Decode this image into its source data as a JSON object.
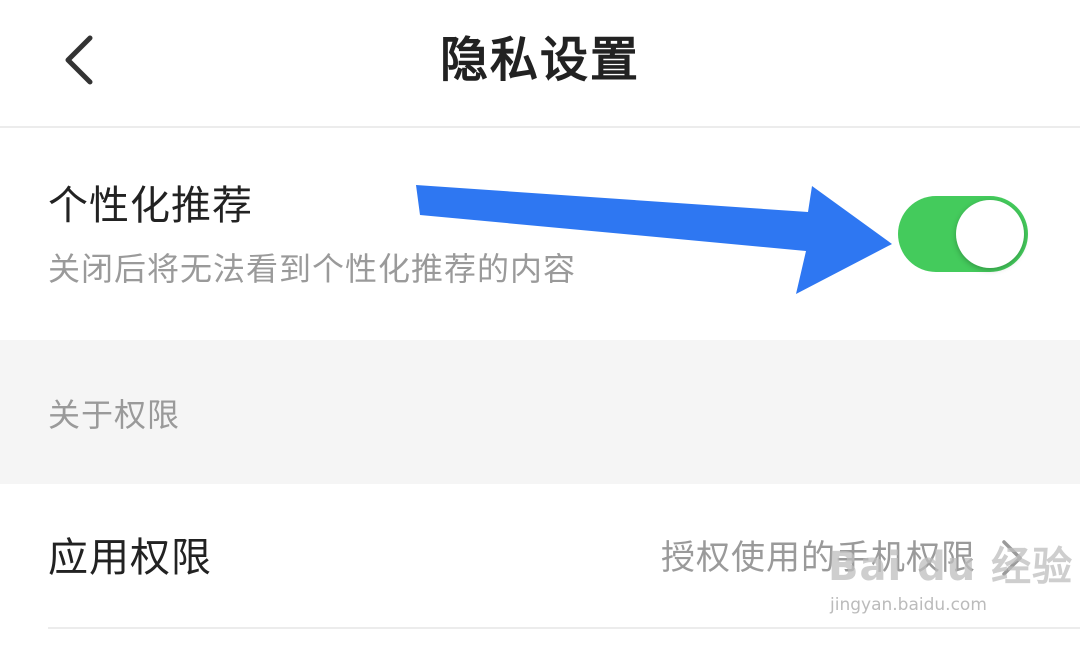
{
  "header": {
    "title": "隐私设置",
    "back_icon": "chevron-left-icon"
  },
  "recommendation": {
    "title": "个性化推荐",
    "description": "关闭后将无法看到个性化推荐的内容",
    "toggle_on": true,
    "toggle_color": "#44cb5c"
  },
  "annotation": {
    "arrow_color": "#2e77f2",
    "arrow_icon": "arrow-right-icon"
  },
  "section": {
    "label": "关于权限"
  },
  "permissions_row": {
    "title": "应用权限",
    "value": "授权使用的手机权限",
    "chevron_icon": "chevron-right-icon"
  },
  "watermark": {
    "logo_text": "Bai du 经验",
    "url": "jingyan.baidu.com"
  },
  "colors": {
    "background": "#ffffff",
    "section_bg": "#f5f5f5",
    "primary_text": "#222222",
    "secondary_text": "#9a9a9a",
    "divider": "#ececec"
  }
}
